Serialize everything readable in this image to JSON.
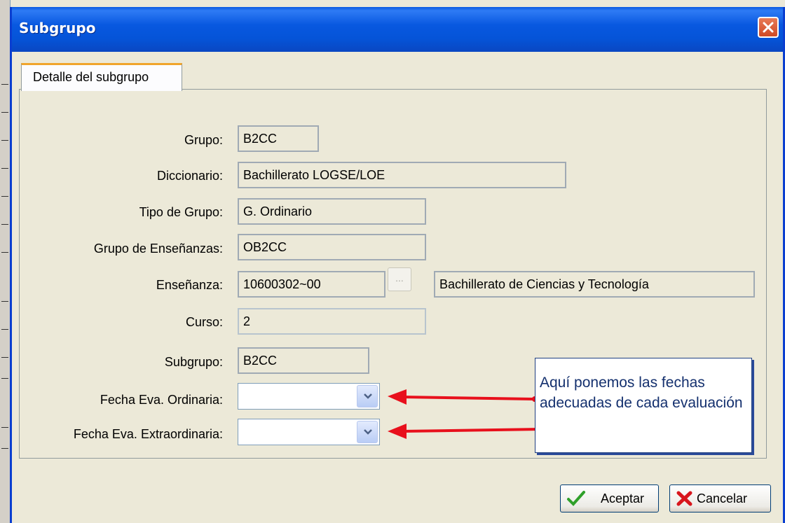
{
  "window": {
    "title": "Subgrupo"
  },
  "tab": {
    "label": "Detalle del subgrupo"
  },
  "fields": [
    {
      "label": "Grupo:",
      "value": "B2CC"
    },
    {
      "label": "Diccionario:",
      "value": "Bachillerato LOGSE/LOE"
    },
    {
      "label": "Tipo de Grupo:",
      "value": "G. Ordinario"
    },
    {
      "label": "Grupo de Enseñanzas:",
      "value": "OB2CC"
    },
    {
      "label": "Enseñanza:",
      "value": "10600302~00",
      "button_label": "...",
      "description": "Bachillerato de Ciencias y Tecnología"
    },
    {
      "label": "Curso:",
      "value": "2"
    },
    {
      "label": "Subgrupo:",
      "value": "B2CC"
    },
    {
      "label": "Fecha Eva. Ordinaria:",
      "value": ""
    },
    {
      "label": "Fecha Eva. Extraordinaria:",
      "value": ""
    }
  ],
  "callout": {
    "text": "Aquí ponemos las fechas adecuadas de cada evaluación"
  },
  "buttons": {
    "accept": "Aceptar",
    "cancel": "Cancelar"
  },
  "colors": {
    "titlebar": "#0554d8",
    "arrow": "#e8101c",
    "tab_accent": "#f0a52c",
    "callout_text": "#14306e"
  },
  "icons": {
    "close": "close-icon",
    "dropdown": "chevron-down-icon",
    "accept": "checkmark-icon",
    "cancel": "cross-icon"
  }
}
